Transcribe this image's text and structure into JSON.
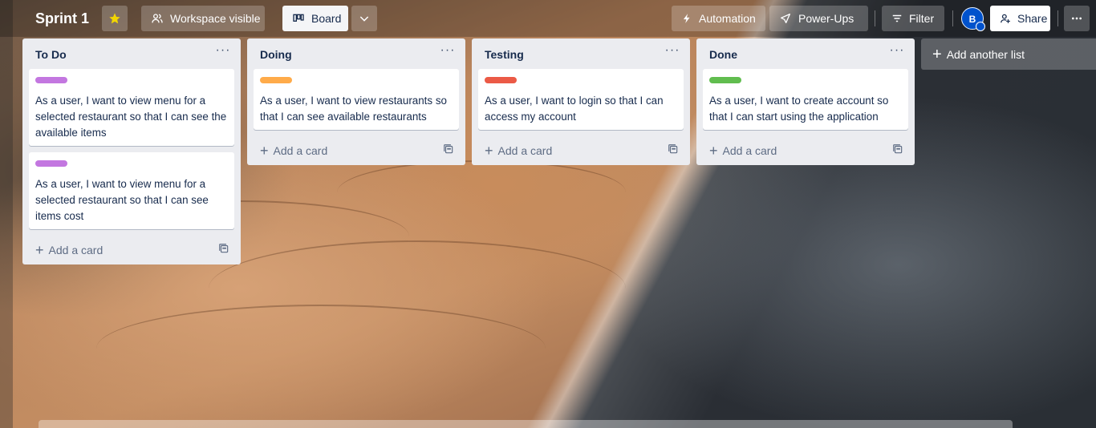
{
  "header": {
    "board_title": "Sprint 1",
    "visibility_label": "Workspace visible",
    "view_label": "Board",
    "automation_label": "Automation",
    "powerups_label": "Power-Ups",
    "filter_label": "Filter",
    "avatar_initial": "B",
    "share_label": "Share",
    "star_color": "#f2d600"
  },
  "lists": [
    {
      "title": "To Do",
      "cards": [
        {
          "label_color": "#c377e0",
          "text": "As a user, I want to view menu for a selected restaurant so that I can see the available items"
        },
        {
          "label_color": "#c377e0",
          "text": "As a user, I want to view menu for a selected restaurant so that I can see items cost"
        }
      ],
      "add_card_label": "Add a card"
    },
    {
      "title": "Doing",
      "cards": [
        {
          "label_color": "#ffab4a",
          "text": "As a user, I want to view restaurants so that I can see available restaurants"
        }
      ],
      "add_card_label": "Add a card"
    },
    {
      "title": "Testing",
      "cards": [
        {
          "label_color": "#eb5a46",
          "text": "As a user, I want to login so that I can access my account"
        }
      ],
      "add_card_label": "Add a card"
    },
    {
      "title": "Done",
      "cards": [
        {
          "label_color": "#61bd4f",
          "text": "As a user, I want to create account so that I can start using the application"
        }
      ],
      "add_card_label": "Add a card"
    }
  ],
  "add_list_label": "Add another list",
  "icons": [
    "star-icon",
    "people-icon",
    "board-icon",
    "chevron-down-icon",
    "lightning-icon",
    "rocket-icon",
    "filter-icon",
    "add-person-icon",
    "more-icon",
    "plus-icon",
    "template-icon"
  ]
}
